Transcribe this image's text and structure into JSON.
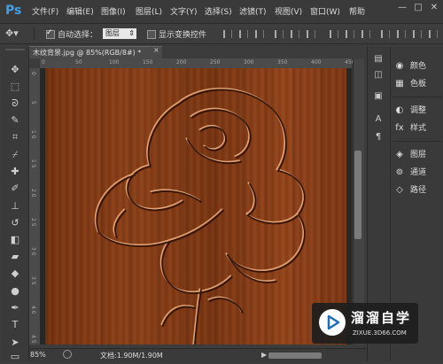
{
  "app": {
    "logo": "Ps"
  },
  "menu": [
    "文件(F)",
    "编辑(E)",
    "图像(I)",
    "图层(L)",
    "文字(Y)",
    "选择(S)",
    "滤镜(T)",
    "视图(V)",
    "窗口(W)",
    "帮助"
  ],
  "window_controls": [
    "—",
    "□",
    "✕"
  ],
  "options": {
    "auto_select_label": "自动选择：",
    "layer_value": "图层",
    "show_transform_label": "显示变换控件",
    "auto_select_checked": true,
    "show_transform_checked": false
  },
  "tools": [
    {
      "name": "move-tool-icon",
      "glyph": "✥"
    },
    {
      "name": "marquee-tool-icon",
      "glyph": "⬚"
    },
    {
      "name": "lasso-tool-icon",
      "glyph": "ᘐ"
    },
    {
      "name": "quick-select-tool-icon",
      "glyph": "✎"
    },
    {
      "name": "crop-tool-icon",
      "glyph": "⌗"
    },
    {
      "name": "eyedropper-tool-icon",
      "glyph": "⌿"
    },
    {
      "name": "healing-tool-icon",
      "glyph": "✚"
    },
    {
      "name": "brush-tool-icon",
      "glyph": "✐"
    },
    {
      "name": "stamp-tool-icon",
      "glyph": "⊥"
    },
    {
      "name": "history-brush-tool-icon",
      "glyph": "↺"
    },
    {
      "name": "eraser-tool-icon",
      "glyph": "◧"
    },
    {
      "name": "gradient-tool-icon",
      "glyph": "▰"
    },
    {
      "name": "blur-tool-icon",
      "glyph": "◆"
    },
    {
      "name": "dodge-tool-icon",
      "glyph": "●"
    },
    {
      "name": "pen-tool-icon",
      "glyph": "✒"
    },
    {
      "name": "type-tool-icon",
      "glyph": "T"
    },
    {
      "name": "path-select-tool-icon",
      "glyph": "➤"
    },
    {
      "name": "shape-tool-icon",
      "glyph": "▭"
    }
  ],
  "document": {
    "tab_title": "木纹背景.jpg @ 85%(RGB/8#) *",
    "close": "×"
  },
  "ruler_top_ticks": [
    "0",
    "50",
    "100",
    "150",
    "200",
    "250",
    "300",
    "350",
    "400",
    "450"
  ],
  "ruler_left_ticks": [
    "0",
    "5",
    "1\n0",
    "1\n5",
    "2\n0",
    "2\n5",
    "3\n0",
    "3\n5",
    "4\n0",
    "4\n5"
  ],
  "status": {
    "zoom": "85%",
    "doc_info": "文档:1.90M/1.90M",
    "arrow": "▶"
  },
  "right_panels": [
    {
      "icon": "palette-icon",
      "glyph": "◉",
      "label": "颜色"
    },
    {
      "icon": "swatches-icon",
      "glyph": "▦",
      "label": "色板"
    },
    {
      "icon": "adjustments-icon",
      "glyph": "◐",
      "label": "调整"
    },
    {
      "icon": "styles-icon",
      "glyph": "fx",
      "label": "样式"
    },
    {
      "icon": "layers-icon",
      "glyph": "◈",
      "label": "图层"
    },
    {
      "icon": "channels-icon",
      "glyph": "⊚",
      "label": "通道"
    },
    {
      "icon": "paths-icon",
      "glyph": "◇",
      "label": "路径"
    }
  ],
  "watermark": {
    "title": "溜溜自学",
    "url": "ZIXUE.3D66.COM"
  }
}
